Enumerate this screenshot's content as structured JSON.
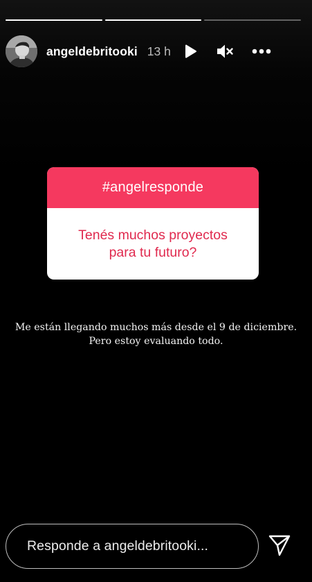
{
  "story": {
    "segments": [
      1,
      1,
      0
    ],
    "user": {
      "username": "angeldebritooki",
      "time_ago": "13 h"
    },
    "header_icons": [
      "play-icon",
      "mute-icon",
      "more-icon"
    ],
    "question_sticker": {
      "tag": "#angelresponde",
      "question": "Tenés muchos proyectos\npara tu futuro?",
      "accent_color": "#f5395f",
      "question_color": "#e0294e"
    },
    "answer_text": "Me están llegando muchos más desde el 9 de diciembre.\nPero estoy evaluando todo."
  },
  "reply": {
    "placeholder": "Responde a angeldebritooki..."
  },
  "icons": {
    "send": "paper-plane-send-icon"
  }
}
